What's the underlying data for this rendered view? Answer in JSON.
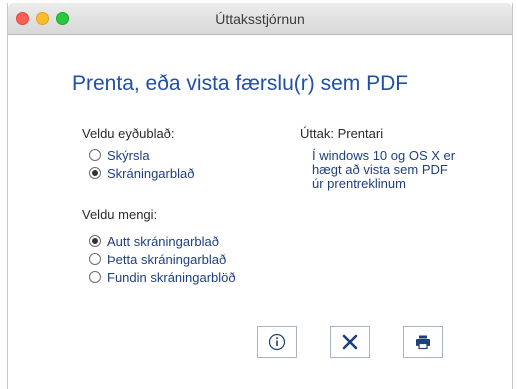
{
  "window": {
    "title": "Úttaksstjórnun"
  },
  "heading": "Prenta, eða vista færslu(r) sem PDF",
  "form_section": {
    "label": "Veldu eyðublað:",
    "options": [
      {
        "label": "Skýrsla",
        "selected": false
      },
      {
        "label": "Skráningarblað",
        "selected": true
      }
    ]
  },
  "output_section": {
    "label": "Úttak: Prentari",
    "description": "Í windows 10 og OS X er hægt að vista sem PDF úr prentreklinum"
  },
  "set_section": {
    "label": "Veldu mengi:",
    "options": [
      {
        "label": "Autt skráningarblað",
        "selected": true
      },
      {
        "label": "Þetta skráningarblað",
        "selected": false
      },
      {
        "label": "Fundin skráningarblöð",
        "selected": false
      }
    ]
  },
  "buttons": {
    "info_icon": "info-icon",
    "close_icon": "close-icon",
    "print_icon": "printer-icon"
  },
  "colors": {
    "heading": "#1f4fa6",
    "option_text": "#1f3f80",
    "button_icon": "#1e3f7a"
  }
}
